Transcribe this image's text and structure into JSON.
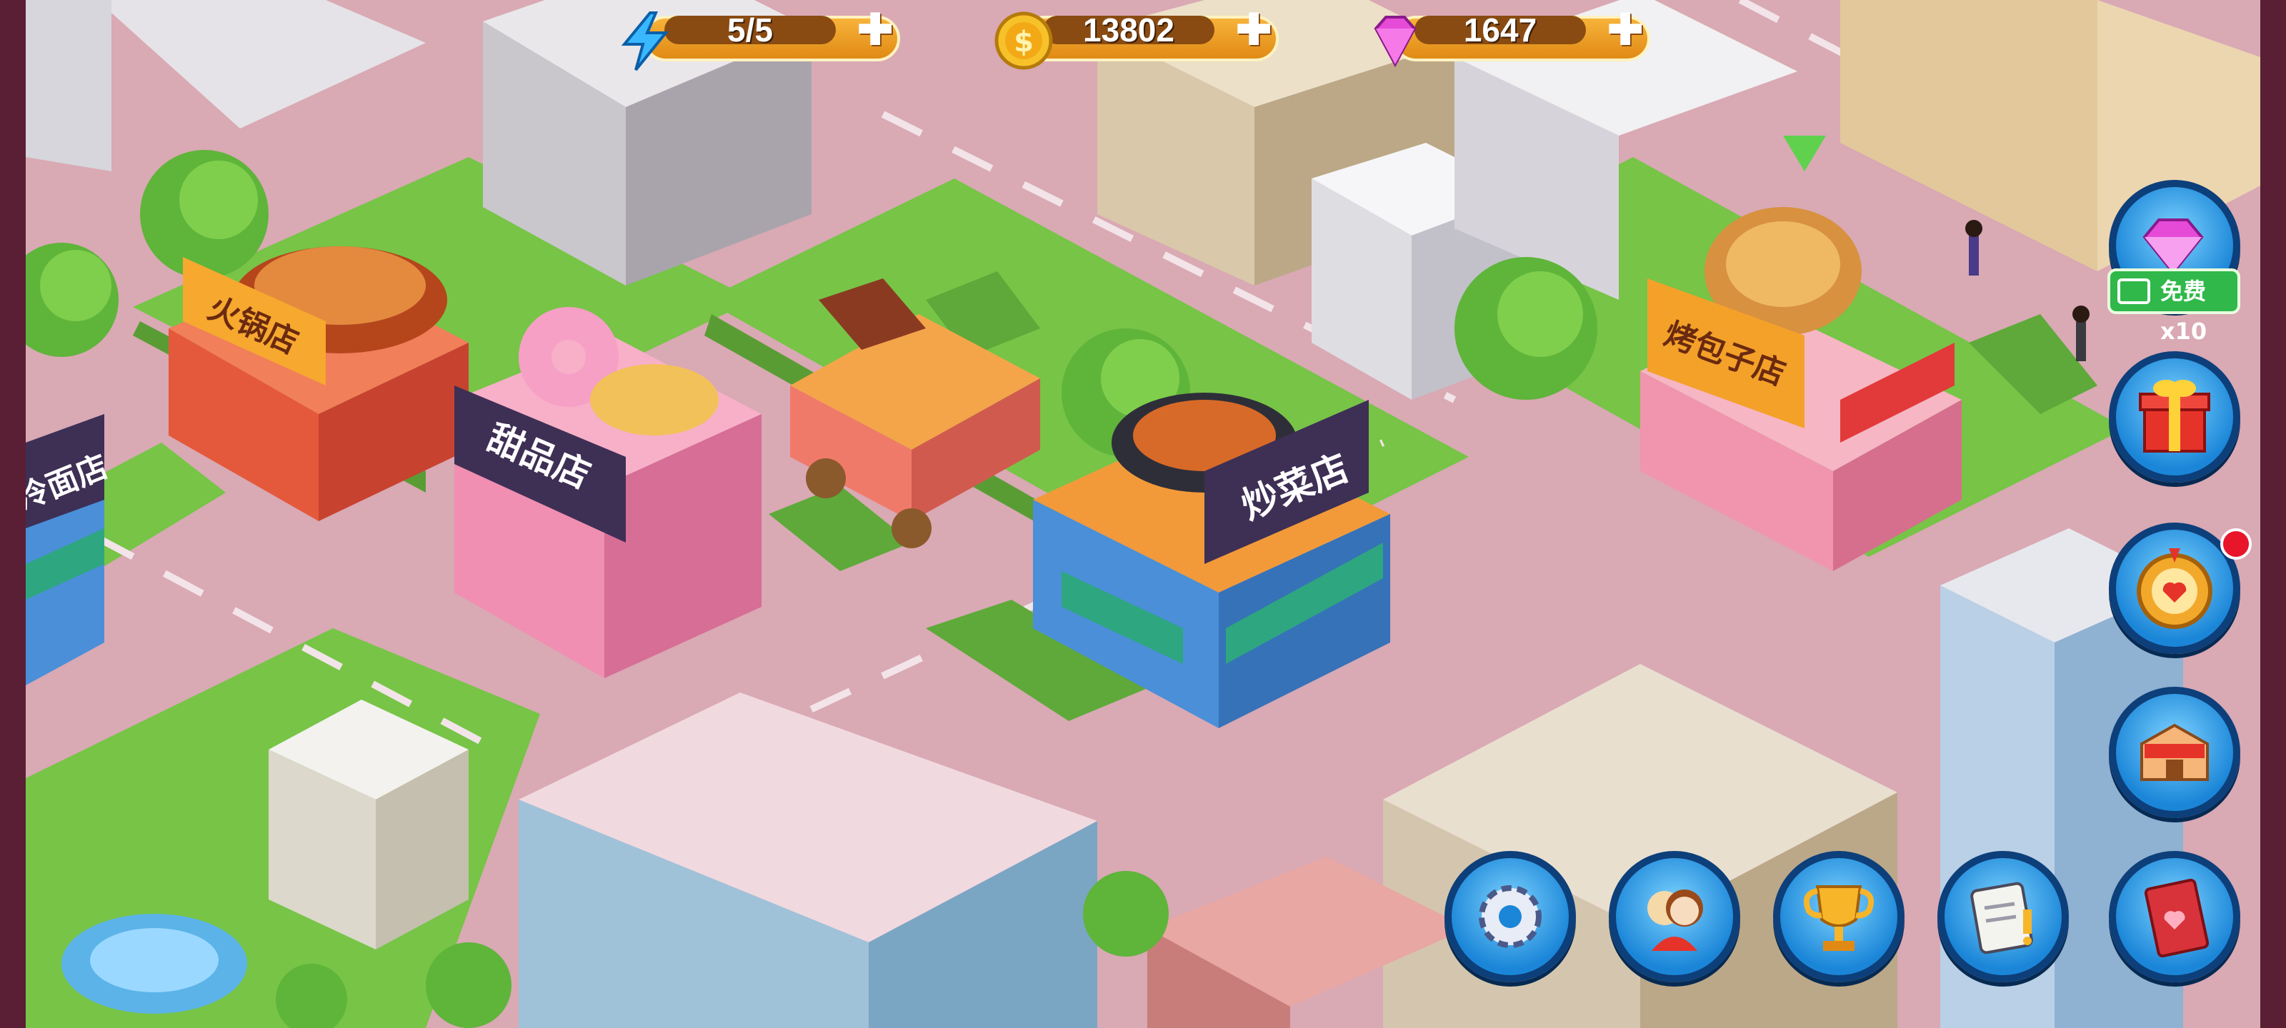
{
  "resources": {
    "energy": {
      "icon": "lightning-icon",
      "value": "5/5",
      "plus": "✚"
    },
    "coins": {
      "icon": "coin-icon",
      "value": "13802",
      "plus": "✚"
    },
    "gems": {
      "icon": "gem-icon",
      "value": "1647",
      "plus": "✚"
    }
  },
  "shops": {
    "hotpot": "火锅店",
    "dessert": "甜品店",
    "stirfry": "炒菜店",
    "bun": "烤包子店",
    "noodle": "冷面店"
  },
  "side_menu": {
    "free_gems_label": "免费x10",
    "items": [
      "gems-icon",
      "gift-box-icon",
      "lucky-wheel-icon",
      "shop-icon",
      "recipe-book-icon"
    ]
  },
  "bottom_menu": {
    "items": [
      "settings-gear-icon",
      "friends-icon",
      "trophy-icon",
      "task-notepad-icon"
    ]
  },
  "colors": {
    "accent": "#f0a02a",
    "button_blue": "#1b86d8",
    "alert_red": "#e8152b",
    "free_green": "#30b84a"
  }
}
